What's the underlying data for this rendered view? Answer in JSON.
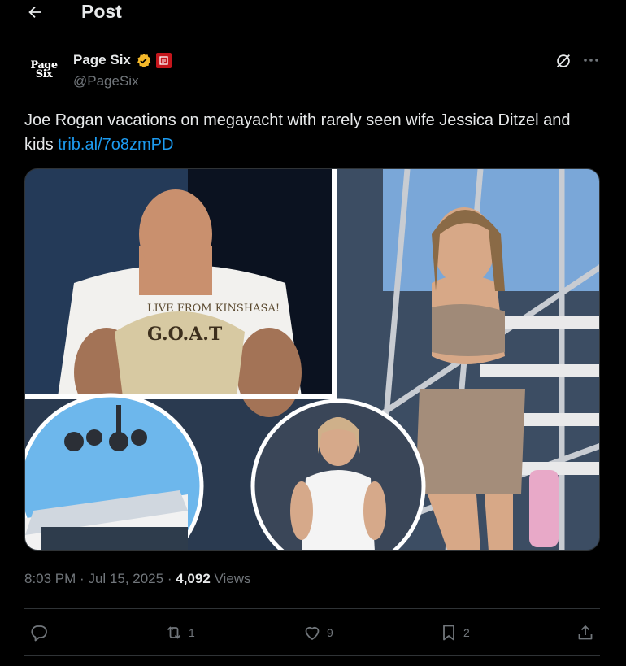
{
  "header": {
    "title": "Post",
    "back_icon": "arrow-left-icon"
  },
  "author": {
    "avatar_text": "Page Six",
    "display_name": "Page Six",
    "handle": "@PageSix",
    "verified_icon": "gold-verified-badge-icon",
    "affiliate_icon": "news-corp-affiliate-icon"
  },
  "tweet": {
    "text": "Joe Rogan vacations on megayacht with rarely seen wife Jessica Ditzel and kids",
    "link": "trib.al/7o8zmPD"
  },
  "meta": {
    "time": "8:03 PM",
    "date": "Jul 15, 2025",
    "views_count": "4,092",
    "views_label": "Views",
    "separator": "·"
  },
  "media": {
    "shirt_text": "LIVE FROM KINSHASA!",
    "shirt_text2": "G.O.A.T"
  },
  "actions": {
    "reply": {
      "icon": "reply-icon",
      "count": ""
    },
    "repost": {
      "icon": "repost-icon",
      "count": "1"
    },
    "like": {
      "icon": "heart-icon",
      "count": "9"
    },
    "bookmark": {
      "icon": "bookmark-icon",
      "count": "2"
    },
    "share": {
      "icon": "share-icon"
    }
  },
  "colors": {
    "accent": "#1d9bf0",
    "muted": "#71767b",
    "text": "#e7e9ea",
    "verified": "#f4b82a"
  }
}
